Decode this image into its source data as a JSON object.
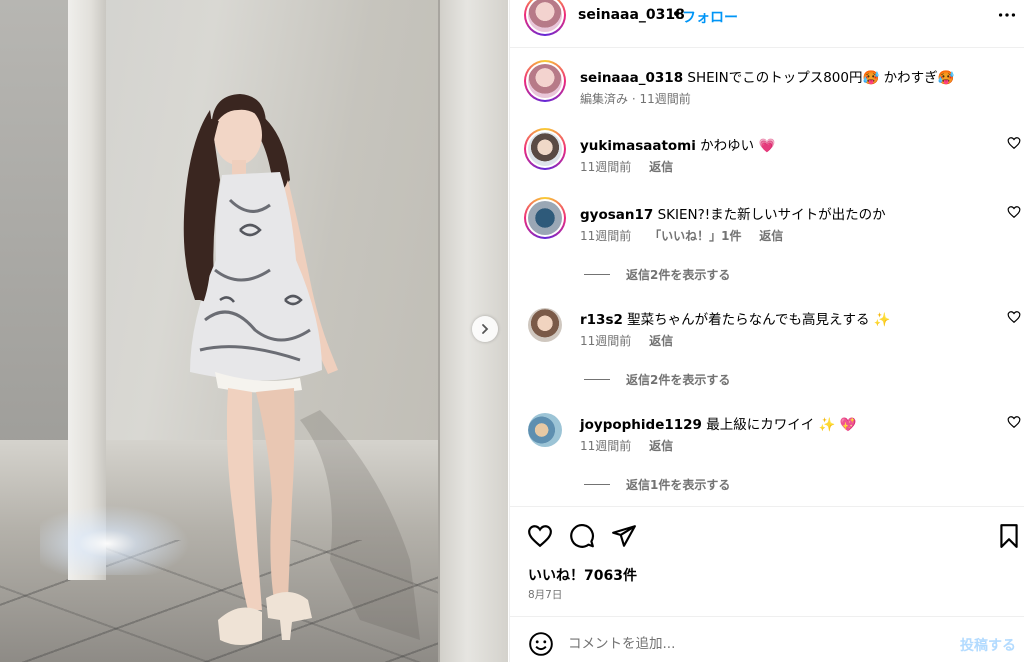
{
  "post": {
    "author": "seinaaa_0318",
    "follow_label": "フォロー",
    "separator": "•",
    "caption_text": "SHEINでこのトップス800円🥵 かわすぎ🥵",
    "caption_meta": "編集済み · 11週間前"
  },
  "comments": [
    {
      "user": "yukimasaatomi",
      "text": "かわゆい 💗",
      "time": "11週間前",
      "likes": "",
      "reply": "返信",
      "view_replies": ""
    },
    {
      "user": "gyosan17",
      "text": "SKIEN?!また新しいサイトが出たのか",
      "time": "11週間前",
      "likes": "「いいね！」1件",
      "reply": "返信",
      "view_replies": "返信2件を表示する"
    },
    {
      "user": "r13s2",
      "text": "聖菜ちゃんが着たらなんでも高見えする ✨",
      "time": "11週間前",
      "likes": "",
      "reply": "返信",
      "view_replies": "返信2件を表示する"
    },
    {
      "user": "joypophide1129",
      "text": "最上級にカワイイ ✨ 💖",
      "time": "11週間前",
      "likes": "",
      "reply": "返信",
      "view_replies": "返信1件を表示する"
    }
  ],
  "stats": {
    "likes": "いいね！7063件",
    "date": "8月7日"
  },
  "composer": {
    "placeholder": "コメントを追加...",
    "post_label": "投稿する"
  },
  "icons": {
    "header_more": "more-horizontal-icon",
    "like": "heart-icon",
    "comment": "comment-icon",
    "share": "paper-plane-icon",
    "save": "bookmark-icon",
    "emoji": "emoji-icon",
    "next": "chevron-right-icon"
  },
  "colors": {
    "link_blue": "#0095f6",
    "muted": "#737373",
    "post_disabled": "#b3dbff"
  }
}
